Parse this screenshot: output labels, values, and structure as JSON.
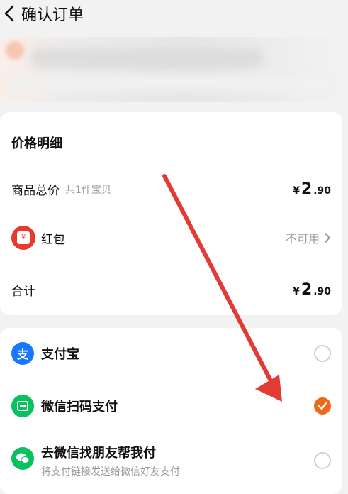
{
  "header": {
    "title": "确认订单"
  },
  "price_detail": {
    "section_title": "价格明细",
    "goods_total": {
      "label": "商品总价",
      "sub": "共1件宝贝",
      "yen": "¥",
      "int": "2",
      "dec": ".90"
    },
    "hongbao": {
      "label": "红包",
      "status": "不可用"
    },
    "total": {
      "label": "合计",
      "yen": "¥",
      "int": "2",
      "dec": ".90"
    }
  },
  "payment": {
    "alipay": {
      "label": "支付宝"
    },
    "wechat_scan": {
      "label": "微信扫码支付",
      "selected": true
    },
    "wechat_friend": {
      "label": "去微信找朋友帮我付",
      "sub": "将支付链接发送给微信好友支付"
    }
  },
  "colors": {
    "alipay": "#1677ff",
    "wechat": "#07c160",
    "accent": "#ee6a17",
    "arrow": "#e23b35"
  }
}
